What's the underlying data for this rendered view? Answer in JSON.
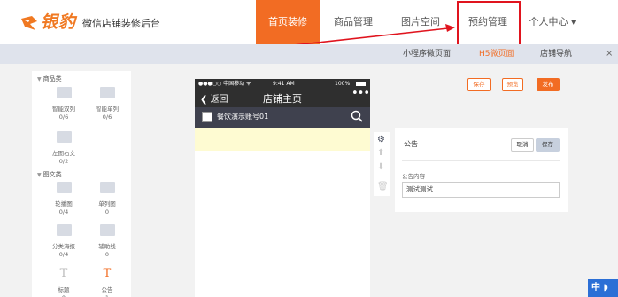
{
  "brand": {
    "logo_text": "银豹",
    "site_title": "微信店铺装修后台",
    "accent": "#f26c23",
    "logo_color": "#f07922"
  },
  "nav": {
    "home": "首页装修",
    "goods": "商品管理",
    "images": "图片空间",
    "booking": "预约管理",
    "user": "个人中心"
  },
  "subnav": {
    "mini": "小程序微页面",
    "h5": "H5微页面",
    "shop_nav": "店铺导航",
    "close": "×"
  },
  "components": {
    "cat_goods": "商品类",
    "cat_text": "图文类",
    "items": [
      {
        "name": "智能双列",
        "count": "0/6",
        "icon": "grid-double-icon"
      },
      {
        "name": "智能单列",
        "count": "0/6",
        "icon": "grid-single-icon"
      },
      {
        "name": "左图右文",
        "count": "0/2",
        "icon": "image-left-text-icon"
      },
      {
        "name": "轮播图",
        "count": "0/4",
        "icon": "carousel-icon"
      },
      {
        "name": "单列图",
        "count": "0",
        "icon": "single-image-icon"
      },
      {
        "name": "分类海报",
        "count": "0/4",
        "icon": "category-poster-icon"
      },
      {
        "name": "辅助线",
        "count": "0",
        "icon": "divider-line-icon"
      },
      {
        "name": "标题",
        "count": "0",
        "icon": "title-icon",
        "glyph": "T"
      },
      {
        "name": "公告",
        "count": "1",
        "icon": "notice-icon",
        "glyph": "T"
      }
    ]
  },
  "actions": {
    "save": "保存",
    "preview": "预览",
    "publish": "发布"
  },
  "phone": {
    "carrier": "●●●○○ 中国移动 ᯤ",
    "time": "9:41 AM",
    "battery": "100%",
    "back": "返回",
    "title": "店铺主页",
    "more": "•••",
    "shop_name": "餐饮演示账号01"
  },
  "editor": {
    "label": "公告",
    "cancel": "取消",
    "save": "保存",
    "field_label": "公告内容",
    "field_value": "测试测试"
  },
  "lang_badge": "中 ◗"
}
